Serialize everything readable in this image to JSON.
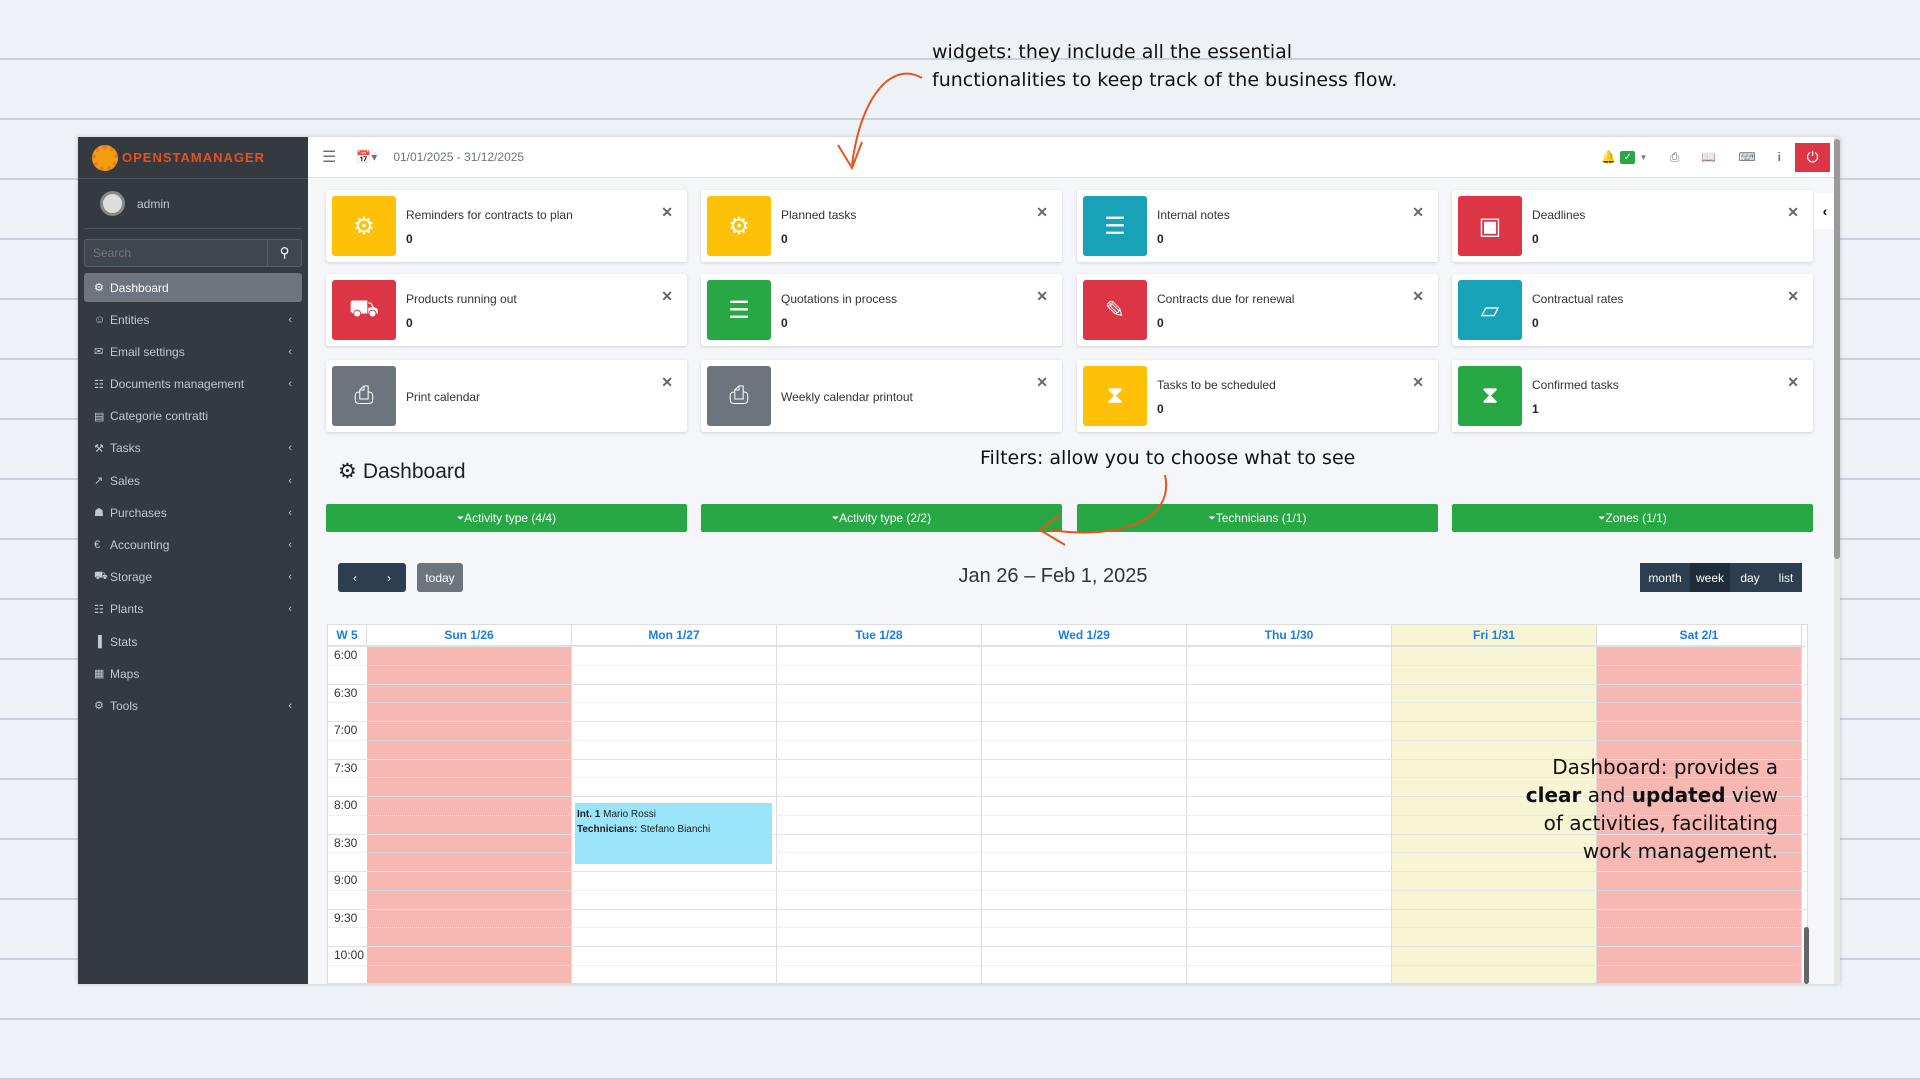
{
  "annotations": {
    "widgets": "widgets: they include all the essential functionalities to keep track of the business flow.",
    "widgets_l1": "widgets: they include all the essential",
    "widgets_l2": "functionalities to keep track of the business flow.",
    "filters": "Filters: allow you to choose what to see",
    "dash_l1": "Dashboard: provides a",
    "dash_l2a": "clear",
    "dash_l2b": " and ",
    "dash_l2c": "updated",
    "dash_l2d": " view",
    "dash_l3": "of activities, facilitating",
    "dash_l4": "work management."
  },
  "brand": "OPENSTAMANAGER",
  "user": "admin",
  "search": {
    "placeholder": "Search"
  },
  "sidebar": [
    {
      "label": "Dashboard",
      "icon": "dashboard-icon",
      "active": true,
      "chev": false
    },
    {
      "label": "Entities",
      "icon": "users-icon",
      "chev": true
    },
    {
      "label": "Email settings",
      "icon": "envelope-icon",
      "chev": true
    },
    {
      "label": "Documents management",
      "icon": "file-icon",
      "chev": true
    },
    {
      "label": "Categorie contratti",
      "icon": "briefcase-icon",
      "chev": false
    },
    {
      "label": "Tasks",
      "icon": "wrench-icon",
      "chev": true
    },
    {
      "label": "Sales",
      "icon": "line-chart-icon",
      "chev": true
    },
    {
      "label": "Purchases",
      "icon": "cart-icon",
      "chev": true
    },
    {
      "label": "Accounting",
      "icon": "euro-icon",
      "chev": true
    },
    {
      "label": "Storage",
      "icon": "truck-icon",
      "chev": true
    },
    {
      "label": "Plants",
      "icon": "sitemap-icon",
      "chev": true
    },
    {
      "label": "Stats",
      "icon": "bar-chart-icon",
      "chev": false
    },
    {
      "label": "Maps",
      "icon": "map-icon",
      "chev": false
    },
    {
      "label": "Tools",
      "icon": "cog-icon",
      "chev": true
    }
  ],
  "topbar": {
    "period": "01/01/2025 - 31/12/2025"
  },
  "widgets": [
    {
      "title": "Reminders for contracts to plan",
      "value": "0",
      "color": "#ffc107",
      "icon": "cog-icon"
    },
    {
      "title": "Planned tasks",
      "value": "0",
      "color": "#ffc107",
      "icon": "cogs-icon"
    },
    {
      "title": "Internal notes",
      "value": "0",
      "color": "#17a2b8",
      "icon": "file-text-icon"
    },
    {
      "title": "Deadlines",
      "value": "0",
      "color": "#dc3545",
      "icon": "money-icon"
    },
    {
      "title": "Products running out",
      "value": "0",
      "color": "#dc3545",
      "icon": "truck-icon"
    },
    {
      "title": "Quotations in process",
      "value": "0",
      "color": "#28a745",
      "icon": "list-icon"
    },
    {
      "title": "Contracts due for renewal",
      "value": "0",
      "color": "#dc3545",
      "icon": "edit-icon"
    },
    {
      "title": "Contractual rates",
      "value": "0",
      "color": "#17a2b8",
      "icon": "folder-open-icon"
    },
    {
      "title": "Print calendar",
      "value": null,
      "color": "#6c757d",
      "icon": "print-icon"
    },
    {
      "title": "Weekly calendar printout",
      "value": null,
      "color": "#6c757d",
      "icon": "print-icon"
    },
    {
      "title": "Tasks to be scheduled",
      "value": "0",
      "color": "#ffc107",
      "icon": "hourglass-icon"
    },
    {
      "title": "Confirmed tasks",
      "value": "1",
      "color": "#28a745",
      "icon": "hourglass-icon"
    }
  ],
  "page_title": "Dashboard",
  "filters": [
    "Activity type (4/4)",
    "Activity type (2/2)",
    "Technicians (1/1)",
    "Zones (1/1)"
  ],
  "calendar": {
    "title": "Jan 26 – Feb 1, 2025",
    "today": "today",
    "views": [
      "month",
      "week",
      "day",
      "list"
    ],
    "active_view": "week",
    "week": "W 5",
    "days": [
      {
        "label": "Sun 1/26",
        "bg": "#f7b8b3"
      },
      {
        "label": "Mon 1/27",
        "bg": null
      },
      {
        "label": "Tue 1/28",
        "bg": null
      },
      {
        "label": "Wed 1/29",
        "bg": null
      },
      {
        "label": "Thu 1/30",
        "bg": null
      },
      {
        "label": "Fri 1/31",
        "bg": "#f8f5d5"
      },
      {
        "label": "Sat 2/1",
        "bg": "#f7b8b3"
      }
    ],
    "times": [
      "6:00",
      "6:30",
      "7:00",
      "7:30",
      "8:00",
      "8:30",
      "9:00",
      "9:30",
      "10:00"
    ],
    "event": {
      "id_label": "Int. 1",
      "client": " Mario Rossi",
      "tech_label": "Technicians:",
      "tech": " Stefano Bianchi",
      "day": 1,
      "start": "8:00",
      "end": "8:50"
    }
  }
}
